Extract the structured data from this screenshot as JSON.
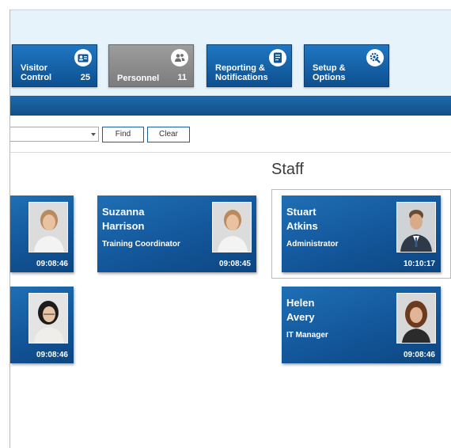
{
  "nav_tiles": [
    {
      "label": "Visitor\nControl",
      "count": "25",
      "icon": "visitor-badge-icon"
    },
    {
      "label": "Personnel",
      "count": "11",
      "icon": "people-icon"
    },
    {
      "label": "Reporting &\nNotifications",
      "icon": "report-icon"
    },
    {
      "label": "Setup &\nOptions",
      "icon": "settings-icon"
    }
  ],
  "search": {
    "value": "",
    "find_label": "Find",
    "clear_label": "Clear"
  },
  "section_title": "Staff",
  "cards": [
    {
      "name": "",
      "role": "",
      "time": "09:08:46"
    },
    {
      "name": "Suzanna\nHarrison",
      "role": "Training Coordinator",
      "time": "09:08:45"
    },
    {
      "name": "Stuart\nAtkins",
      "role": "Administrator",
      "time": "10:10:17"
    },
    {
      "name": "",
      "role": "",
      "time": "09:08:46"
    },
    {
      "name": "Helen\nAvery",
      "role": "IT Manager",
      "time": "09:08:46"
    }
  ],
  "colors": {
    "accent": "#13569a",
    "header_bg": "#e7f3fb",
    "active_tile": "#8c8c8c"
  }
}
